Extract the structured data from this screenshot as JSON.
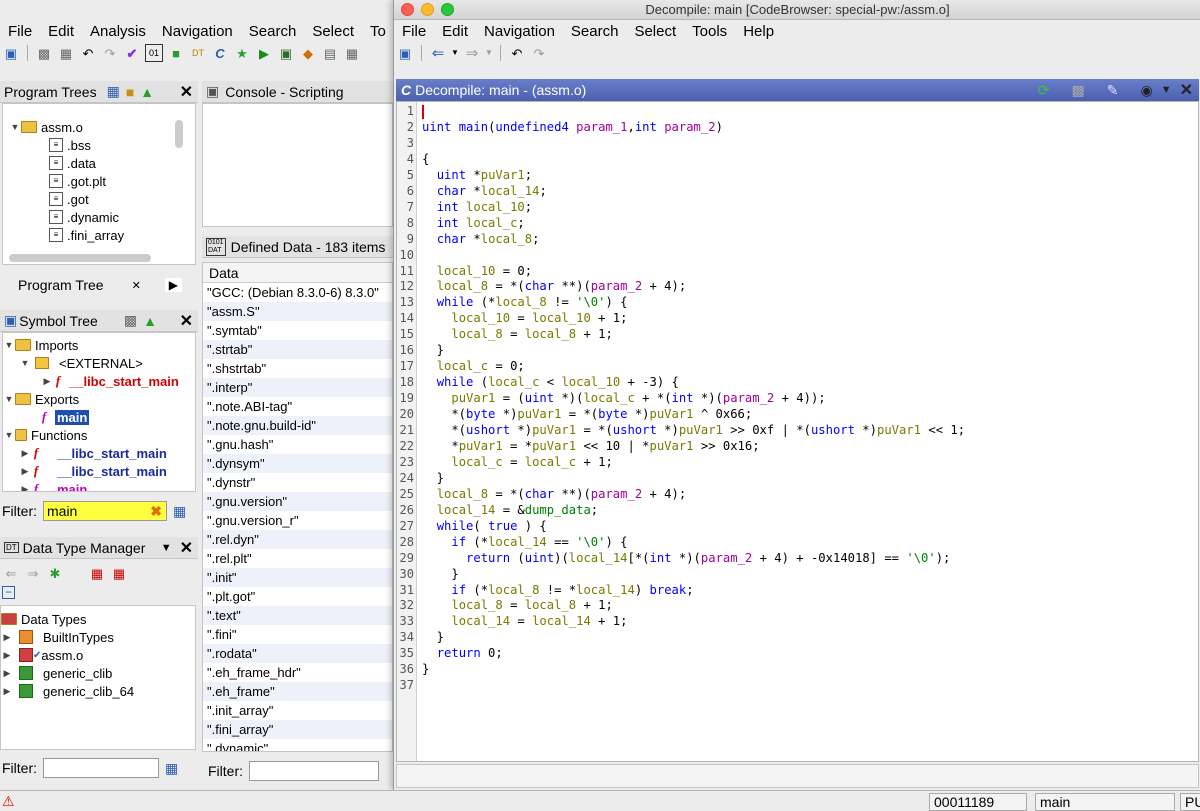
{
  "bg": {
    "menu": [
      "File",
      "Edit",
      "Analysis",
      "Navigation",
      "Search",
      "Select",
      "To"
    ],
    "program_trees": {
      "title": "Program Trees",
      "root": "assm.o",
      "items": [
        ".bss",
        ".data",
        ".got.plt",
        ".got",
        ".dynamic",
        ".fini_array"
      ],
      "tab_label": "Program Tree"
    },
    "console": {
      "title": "Console - Scripting"
    },
    "defined_data": {
      "title": "Defined Data - 183 items",
      "column": "Data",
      "rows": [
        "\"GCC: (Debian 8.3.0-6) 8.3.0\"",
        "\"assm.S\"",
        "\".symtab\"",
        "\".strtab\"",
        "\".shstrtab\"",
        "\".interp\"",
        "\".note.ABI-tag\"",
        "\".note.gnu.build-id\"",
        "\".gnu.hash\"",
        "\".dynsym\"",
        "\".dynstr\"",
        "\".gnu.version\"",
        "\".gnu.version_r\"",
        "\".rel.dyn\"",
        "\".rel.plt\"",
        "\".init\"",
        "\".plt.got\"",
        "\".text\"",
        "\".fini\"",
        "\".rodata\"",
        "\".eh_frame_hdr\"",
        "\".eh_frame\"",
        "\".init_array\"",
        "\".fini_array\"",
        "\".dynamic\""
      ],
      "filter_label": "Filter:"
    },
    "symbol_tree": {
      "title": "Symbol Tree",
      "imports": "Imports",
      "external": "<EXTERNAL>",
      "libc_start_main": "__libc_start_main",
      "exports": "Exports",
      "main": "main",
      "functions": "Functions",
      "fn1": "__libc_start_main",
      "fn2": "__libc_start_main",
      "fn3": "main",
      "filter_label": "Filter:",
      "filter_value": "main"
    },
    "data_type_manager": {
      "title": "Data Type Manager",
      "root": "Data Types",
      "items": [
        "BuiltInTypes",
        "assm.o",
        "generic_clib",
        "generic_clib_64"
      ],
      "filter_label": "Filter:"
    }
  },
  "front": {
    "window_title": "Decompile: main [CodeBrowser: special-pw:/assm.o]",
    "menu": [
      "File",
      "Edit",
      "Navigation",
      "Search",
      "Select",
      "Tools",
      "Help"
    ],
    "panel_title": "Decompile: main -  (assm.o)",
    "line_numbers": [
      "1",
      "2",
      "3",
      "4",
      "5",
      "6",
      "7",
      "8",
      "9",
      "10",
      "11",
      "12",
      "13",
      "14",
      "15",
      "16",
      "17",
      "18",
      "19",
      "20",
      "21",
      "22",
      "23",
      "24",
      "25",
      "26",
      "27",
      "28",
      "29",
      "30",
      "31",
      "32",
      "33",
      "34",
      "35",
      "36",
      "37"
    ],
    "code_lines": [
      "",
      "uint main(undefined4 param_1,int param_2)",
      "",
      "{",
      "  uint *puVar1;",
      "  char *local_14;",
      "  int local_10;",
      "  int local_c;",
      "  char *local_8;",
      "",
      "  local_10 = 0;",
      "  local_8 = *(char **)(param_2 + 4);",
      "  while (*local_8 != '\\0') {",
      "    local_10 = local_10 + 1;",
      "    local_8 = local_8 + 1;",
      "  }",
      "  local_c = 0;",
      "  while (local_c < local_10 + -3) {",
      "    puVar1 = (uint *)(local_c + *(int *)(param_2 + 4));",
      "    *(byte *)puVar1 = *(byte *)puVar1 ^ 0x66;",
      "    *(ushort *)puVar1 = *(ushort *)puVar1 >> 0xf | *(ushort *)puVar1 << 1;",
      "    *puVar1 = *puVar1 << 10 | *puVar1 >> 0x16;",
      "    local_c = local_c + 1;",
      "  }",
      "  local_8 = *(char **)(param_2 + 4);",
      "  local_14 = &dump_data;",
      "  while( true ) {",
      "    if (*local_14 == '\\0') {",
      "      return (uint)(local_14[*(int *)(param_2 + 4) + -0x14018] == '\\0');",
      "    }",
      "    if (*local_8 != *local_14) break;",
      "    local_8 = local_8 + 1;",
      "    local_14 = local_14 + 1;",
      "  }",
      "  return 0;",
      "}",
      ""
    ]
  },
  "status": {
    "address": "00011189",
    "function": "main",
    "extra": "PU"
  }
}
